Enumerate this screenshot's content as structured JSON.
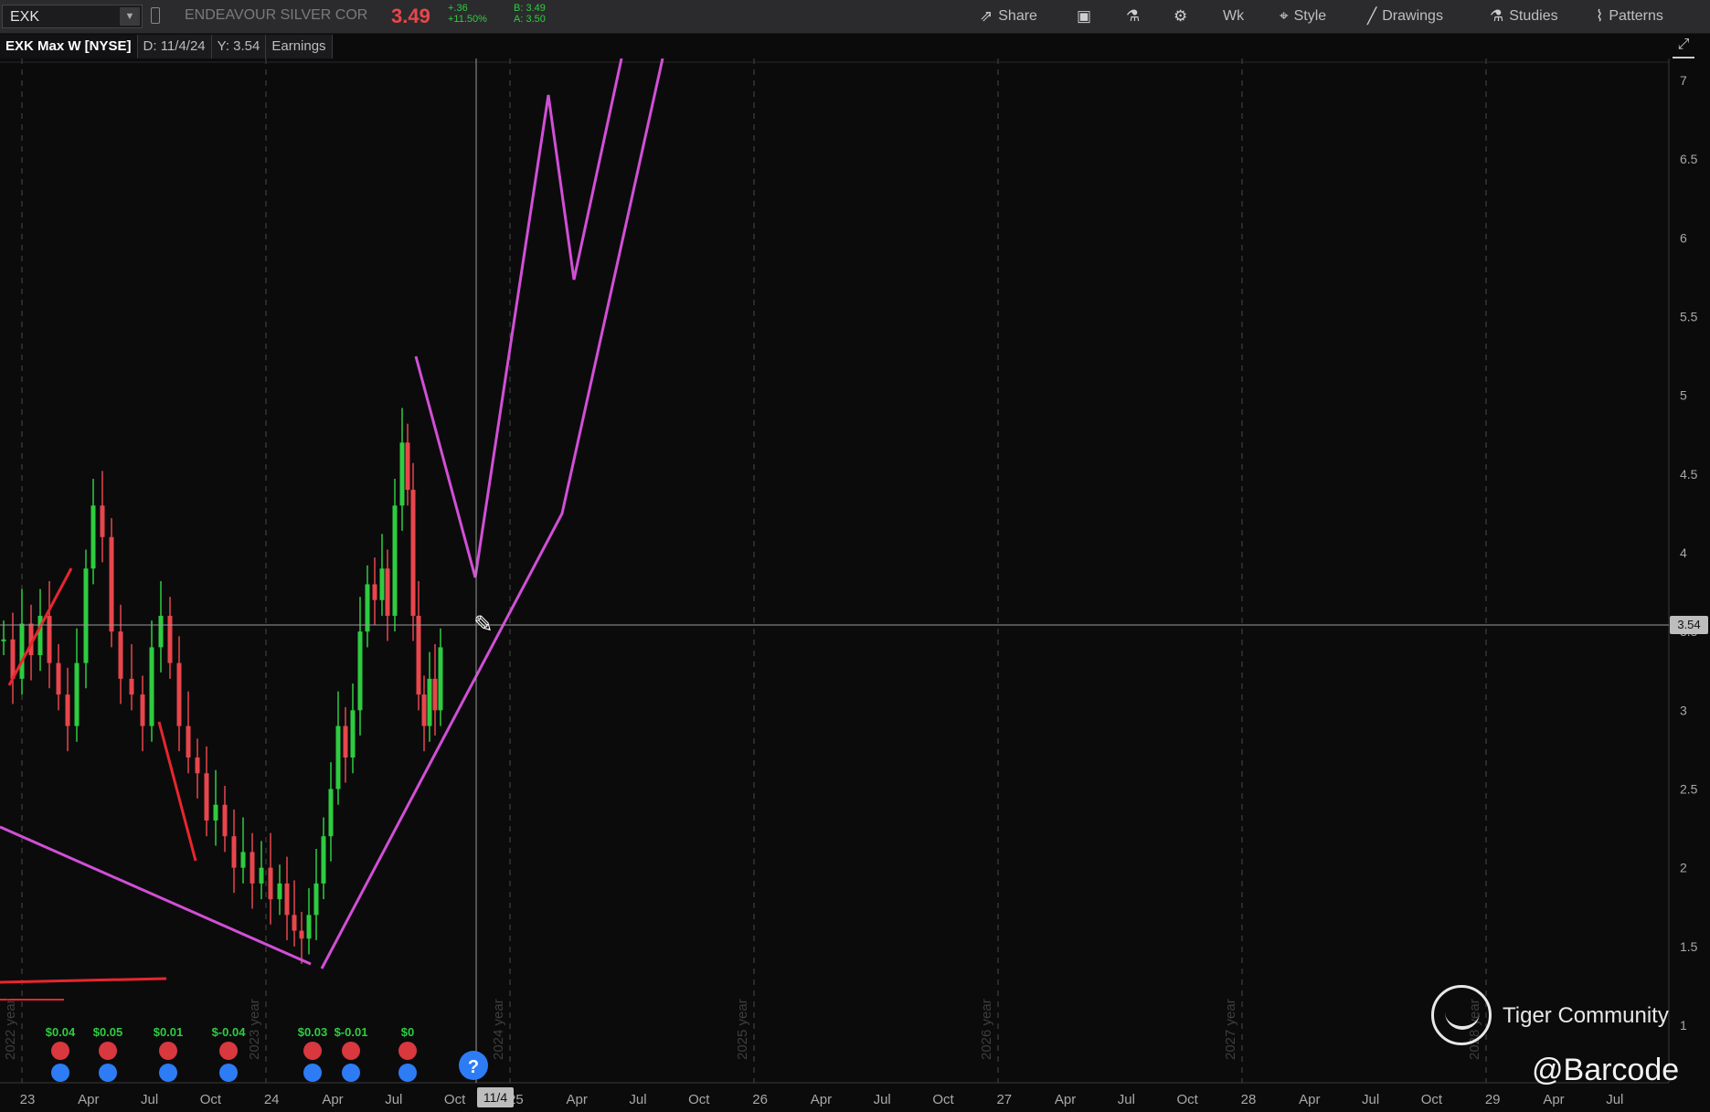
{
  "toolbar": {
    "symbol": "EXK",
    "company": "ENDEAVOUR SILVER COR",
    "last_price": "3.49",
    "change_abs": "+.36",
    "change_pct": "+11.50%",
    "bid": "B: 3.49",
    "ask": "A: 3.50",
    "buttons": {
      "share": "Share",
      "period": "Wk",
      "style": "Style",
      "drawings": "Drawings",
      "studies": "Studies",
      "patterns": "Patterns"
    },
    "icons": [
      "share-icon",
      "calendar-icon",
      "flask-icon",
      "gear-icon",
      "style-icon",
      "pencil-icon",
      "studies-icon",
      "patterns-icon"
    ]
  },
  "infobar": {
    "title": "EXK Max W [NYSE]",
    "date": "D: 11/4/24",
    "y": "Y: 3.54",
    "earnings": "Earnings"
  },
  "chart_data": {
    "type": "candlestick",
    "title": "",
    "xlabel": "",
    "ylabel": "",
    "ylim": [
      1.0,
      7.2
    ],
    "y_ticks": [
      "7",
      "6.5",
      "6",
      "5.5",
      "5",
      "4.5",
      "4",
      "3.5",
      "3",
      "2.5",
      "2",
      "1.5",
      "1"
    ],
    "x_ticks": [
      "23",
      "Apr",
      "Jul",
      "Oct",
      "24",
      "Apr",
      "Jul",
      "Oct",
      "25",
      "Apr",
      "Jul",
      "Oct",
      "26",
      "Apr",
      "Jul",
      "Oct",
      "27",
      "Apr",
      "Jul",
      "Oct",
      "28",
      "Apr",
      "Jul",
      "Oct",
      "29",
      "Apr",
      "Jul"
    ],
    "year_labels": [
      "2022 year",
      "2023 year",
      "2024 year",
      "2025 year",
      "2026 year",
      "2027 year",
      "2028 year"
    ],
    "cursor_date_label": "11/4",
    "cursor_price_label": "3.54",
    "cursor_price": 3.54,
    "earnings_labels": [
      "$0.04",
      "$0.05",
      "$0.01",
      "$-0.04",
      "$0.03",
      "$-0.01",
      "$0"
    ],
    "grid": true,
    "colors": {
      "up": "#2ecc40",
      "down": "#e8464c",
      "drawing": "#d24fd6",
      "red_line": "#e8262e",
      "background": "#0b0b0c"
    }
  },
  "watermark": {
    "text": "Tiger Community",
    "handle": "@Barcode"
  }
}
